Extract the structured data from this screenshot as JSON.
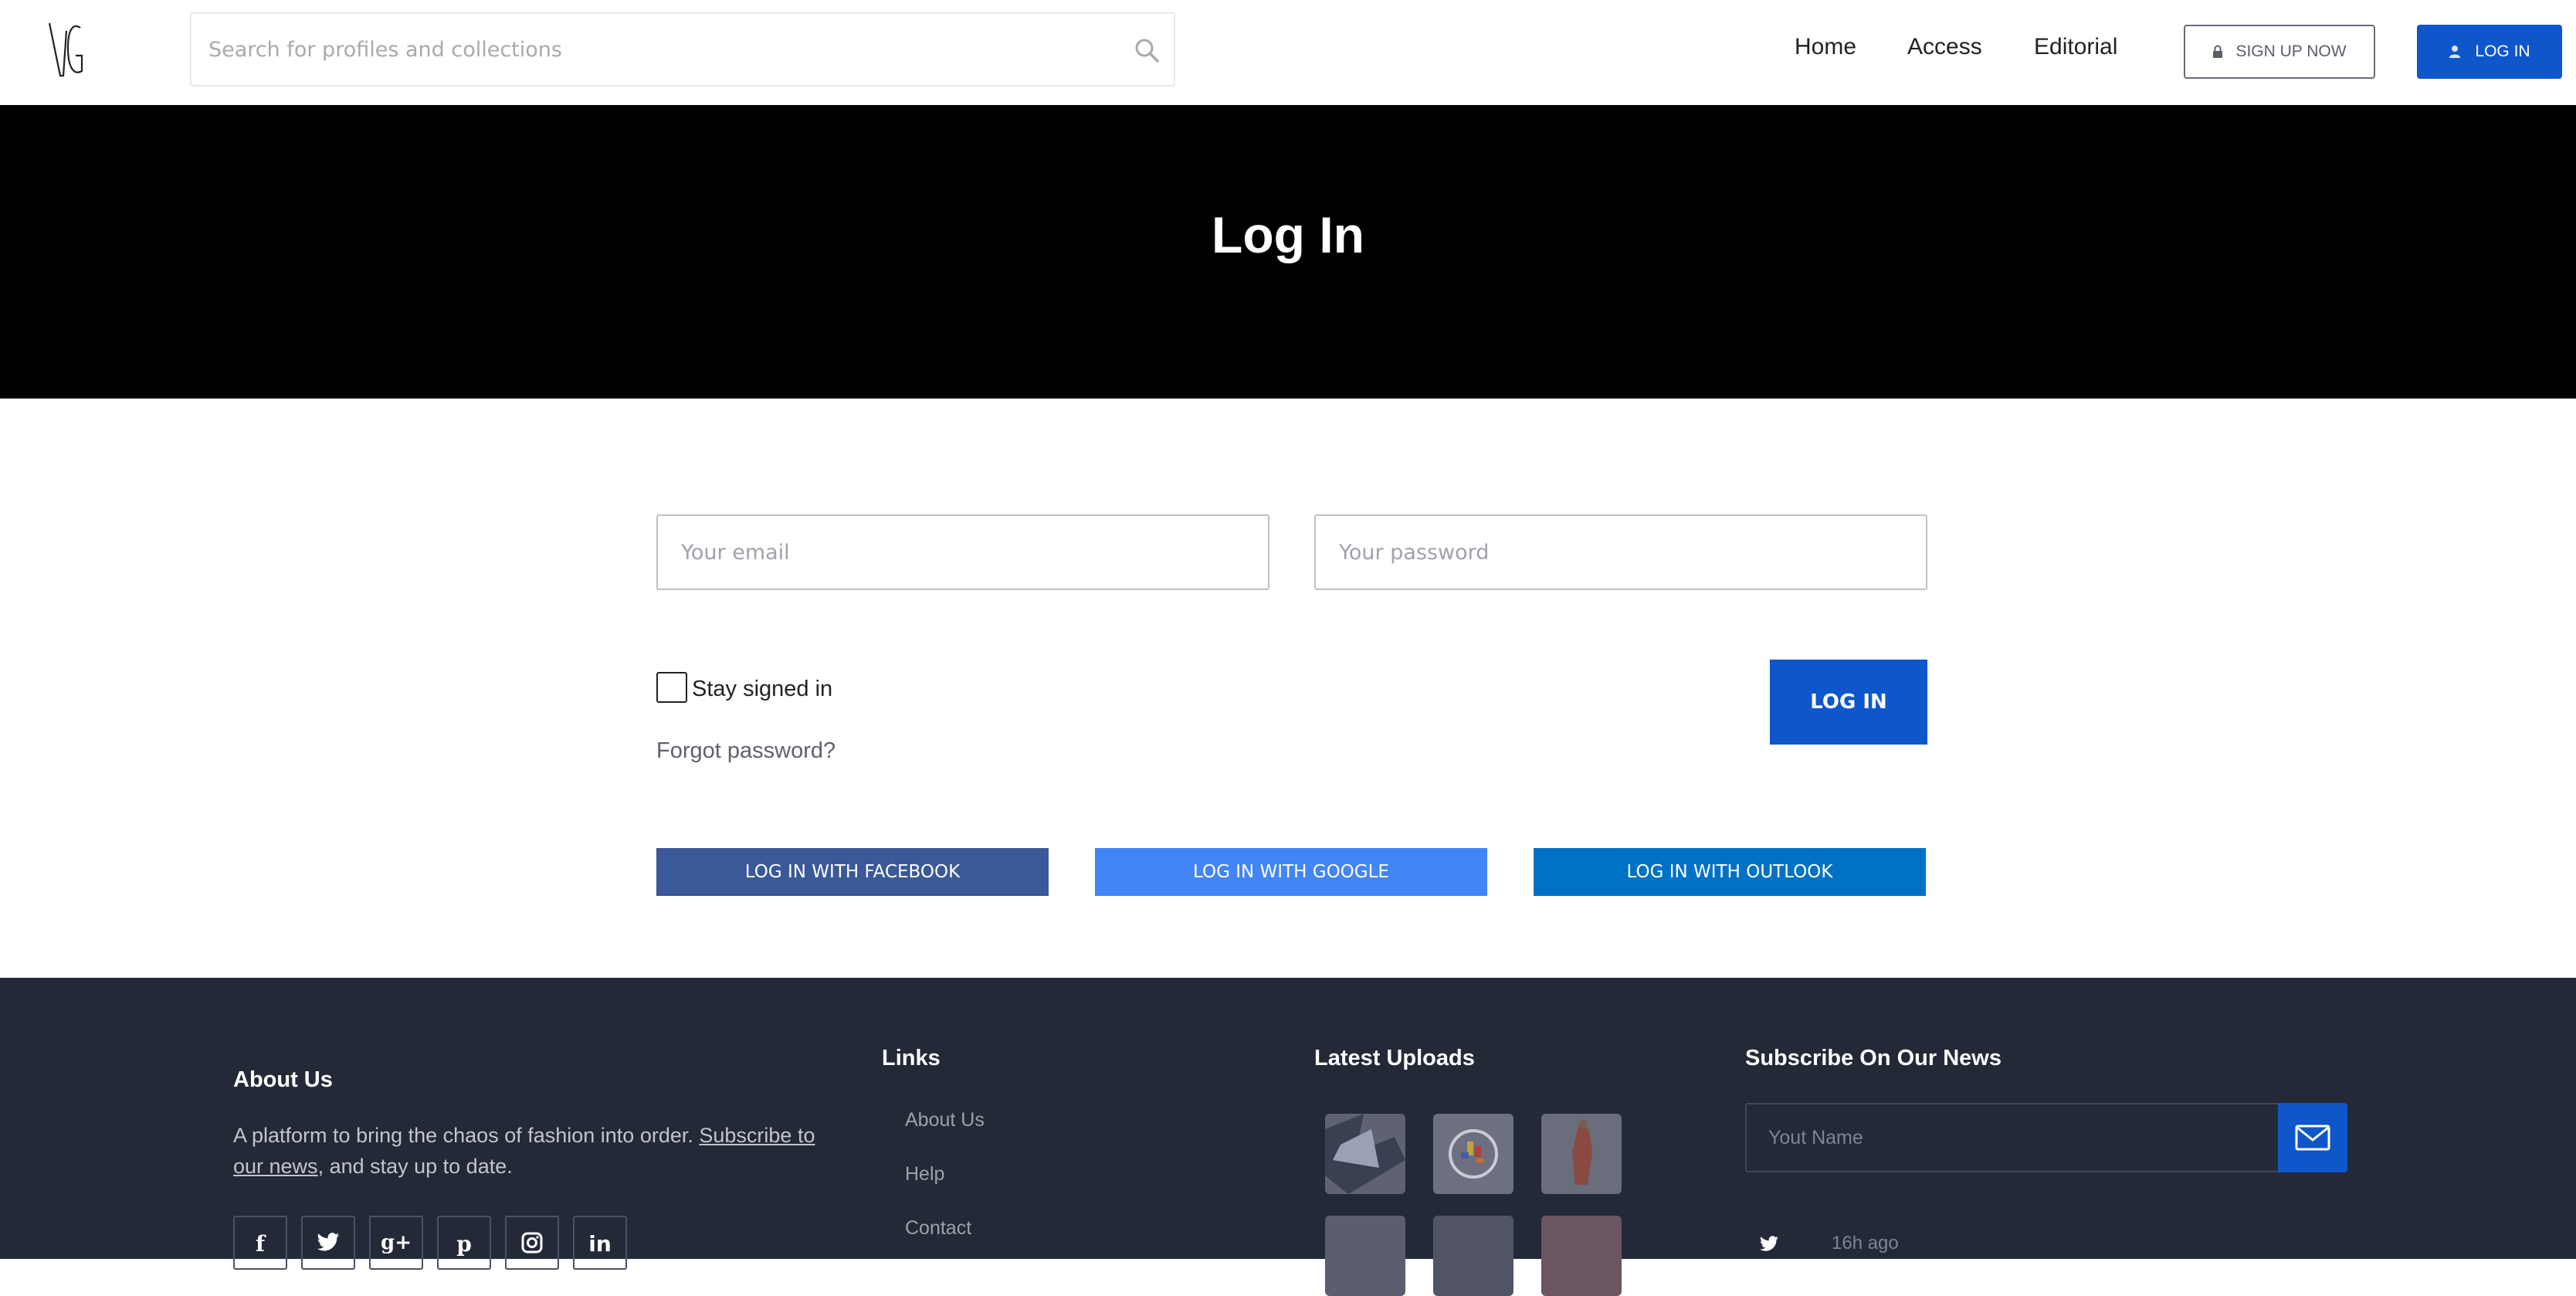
{
  "header": {
    "search_placeholder": "Search for profiles and collections",
    "nav": [
      "Home",
      "Access",
      "Editorial"
    ],
    "signup_label": "SIGN UP NOW",
    "login_label": "LOG IN"
  },
  "hero": {
    "title": "Log In"
  },
  "form": {
    "email_placeholder": "Your email",
    "password_placeholder": "Your password",
    "stay_signed_in": "Stay signed in",
    "forgot": "Forgot password?",
    "login_button": "LOG IN",
    "social": [
      {
        "label": "LOG IN WITH FACEBOOK",
        "color": "#3b5998"
      },
      {
        "label": "LOG IN WITH GOOGLE",
        "color": "#4285f4"
      },
      {
        "label": "LOG IN WITH OUTLOOK",
        "color": "#0072c6"
      }
    ]
  },
  "footer": {
    "about_title": "About Us",
    "about_text": "A platform to bring the chaos of fashion into order. ",
    "about_link": "Subscribe to our news",
    "about_text_end": ", and stay up to date.",
    "social_icons": [
      "facebook-icon",
      "twitter-icon",
      "google-plus-icon",
      "pinterest-icon",
      "instagram-icon",
      "linkedin-icon"
    ],
    "links_title": "Links",
    "links": [
      "About Us",
      "Help",
      "Contact"
    ],
    "uploads_title": "Latest Uploads",
    "subscribe_title": "Subscribe On Our News",
    "subscribe_placeholder": "Yout Name",
    "tweet_time": "16h ago"
  },
  "colors": {
    "accent": "#0e56c9",
    "footer_bg": "#242938",
    "hero_bg": "#000000"
  }
}
